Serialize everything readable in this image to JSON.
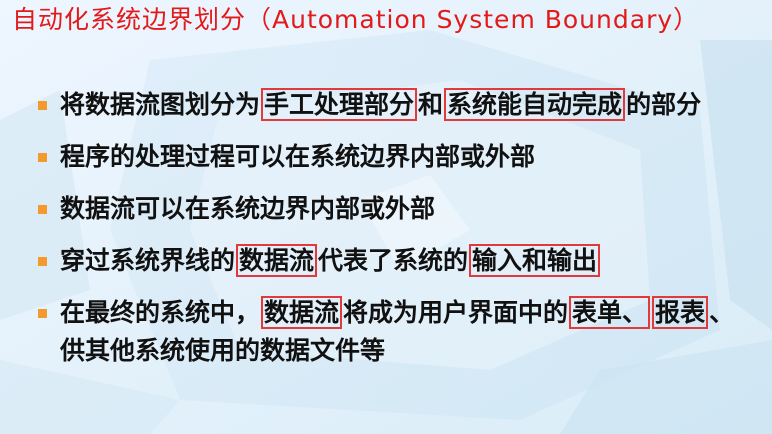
{
  "title": {
    "cn": "自动化系统边界划分",
    "en": "（Automation System Boundary）"
  },
  "bullets": [
    {
      "segments": [
        {
          "text": "将数据流图划分为",
          "boxed": false
        },
        {
          "text": "手工处理部分",
          "boxed": true
        },
        {
          "text": "和",
          "boxed": false
        },
        {
          "text": "系统能自动完成",
          "boxed": true
        },
        {
          "text": "的部分",
          "boxed": false
        }
      ]
    },
    {
      "segments": [
        {
          "text": "程序的处理过程可以在系统边界内部或外部",
          "boxed": false
        }
      ]
    },
    {
      "segments": [
        {
          "text": "数据流可以在系统边界内部或外部",
          "boxed": false
        }
      ]
    },
    {
      "segments": [
        {
          "text": "穿过系统界线的",
          "boxed": false
        },
        {
          "text": "数据流",
          "boxed": true
        },
        {
          "text": "代表了系统的",
          "boxed": false
        },
        {
          "text": "输入和输出",
          "boxed": true
        }
      ]
    },
    {
      "segments": [
        {
          "text": "在最终的系统中，",
          "boxed": false
        },
        {
          "text": "数据流",
          "boxed": true
        },
        {
          "text": "将成为用户界面中的",
          "boxed": false
        },
        {
          "text": "表单、",
          "boxed": true
        },
        {
          "text": "报表",
          "boxed": true
        },
        {
          "text": "、供其他系统使用的数据文件等",
          "boxed": false
        }
      ]
    }
  ],
  "colors": {
    "title": "#e21a1a",
    "bullet_marker": "#f29a2e",
    "highlight_box": "#e23a3a",
    "body_text": "#111111"
  }
}
